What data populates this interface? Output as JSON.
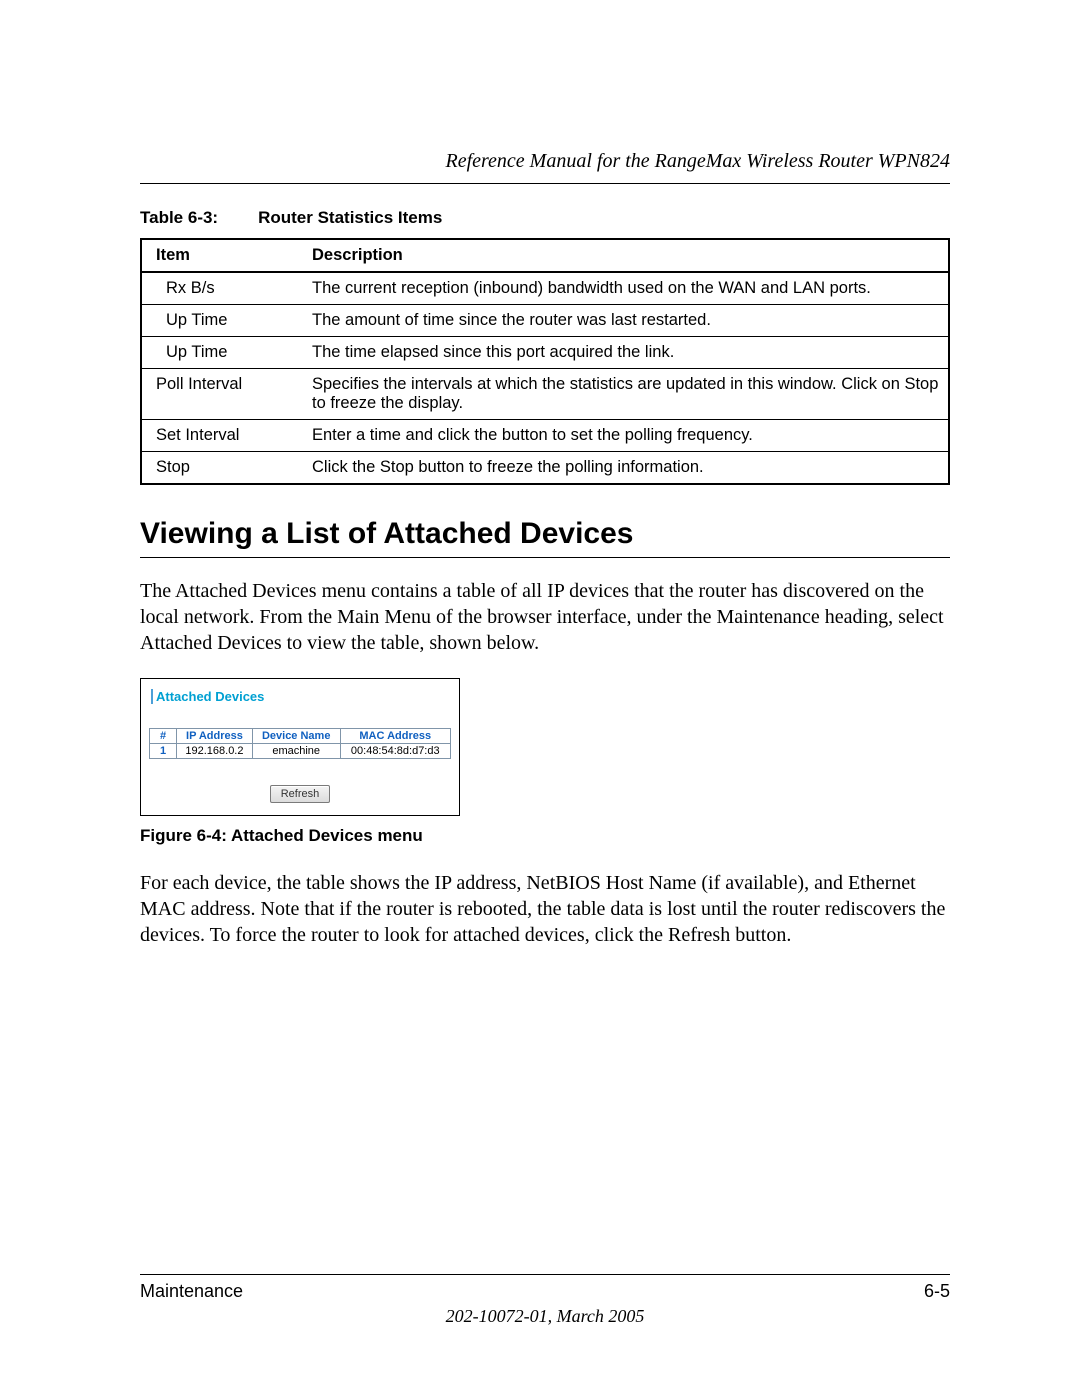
{
  "header": {
    "doc_title": "Reference Manual for the RangeMax Wireless Router WPN824"
  },
  "stats_table": {
    "caption_prefix": "Table 6-3:",
    "caption_title": "Router Statistics Items",
    "headers": {
      "item": "Item",
      "description": "Description"
    },
    "rows": [
      {
        "item": "Rx B/s",
        "indent": true,
        "description": "The current reception (inbound) bandwidth used on the WAN and LAN ports."
      },
      {
        "item": "Up Time",
        "indent": true,
        "description": "The amount of time since the router was last restarted."
      },
      {
        "item": "Up Time",
        "indent": true,
        "description": "The time elapsed since this port acquired the link."
      },
      {
        "item": "Poll Interval",
        "indent": false,
        "description": "Specifies the intervals at which the statistics are updated in this window. Click on Stop to freeze the display."
      },
      {
        "item": "Set Interval",
        "indent": false,
        "description": "Enter a time and click the button to set the polling frequency."
      },
      {
        "item": "Stop",
        "indent": false,
        "description": "Click the Stop button to freeze the polling information."
      }
    ]
  },
  "section": {
    "heading": "Viewing a List of Attached Devices",
    "para1": "The Attached Devices menu contains a table of all IP devices that the router has discovered on the local network. From the Main Menu of the browser interface, under the Maintenance heading, select Attached Devices to view the table, shown below.",
    "para2": "For each device, the table shows the IP address, NetBIOS Host Name (if available), and Ethernet MAC address. Note that if the router is rebooted, the table data is lost until the router rediscovers the devices. To force the router to look for attached devices, click the Refresh button."
  },
  "attached_devices": {
    "panel_title": "Attached Devices",
    "headers": {
      "num": "#",
      "ip": "IP Address",
      "name": "Device Name",
      "mac": "MAC Address"
    },
    "rows": [
      {
        "num": "1",
        "ip": "192.168.0.2",
        "name": "emachine",
        "mac": "00:48:54:8d:d7:d3"
      }
    ],
    "refresh_label": "Refresh",
    "figure_caption": "Figure 6-4:  Attached Devices menu"
  },
  "footer": {
    "left": "Maintenance",
    "right": "6-5",
    "sub": "202-10072-01, March 2005"
  }
}
